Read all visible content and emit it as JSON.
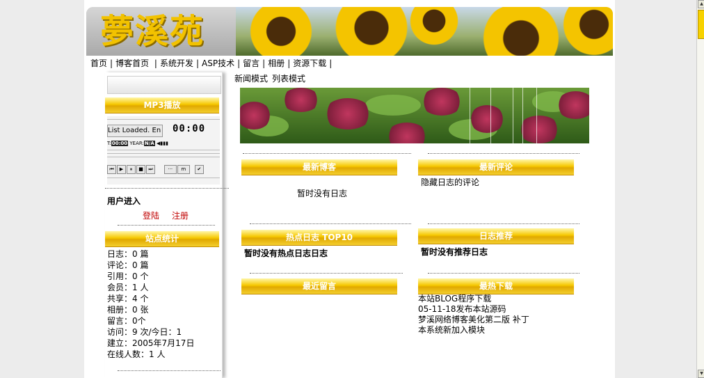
{
  "site": {
    "logo_text": "夢溪苑"
  },
  "nav": {
    "items": [
      "首页",
      "博客首页",
      "系统开发",
      "ASP技术",
      "留言",
      "相册",
      "资源下载"
    ]
  },
  "modes": {
    "news": "新闻模式",
    "list": "列表模式"
  },
  "sidebar": {
    "mp3": {
      "title": "MP3播放",
      "list_status": "List Loaded. En",
      "time": "00:00",
      "t_label": "T:",
      "t_value": "00:00",
      "year_label": "YEAR:",
      "year_value": "N/A",
      "buttons": [
        "⏮",
        "▶",
        "⏸",
        "■",
        "⏭",
        "···",
        "m",
        "✔"
      ]
    },
    "user": {
      "title": "用户进入",
      "login": "登陆",
      "register": "注册"
    },
    "stats": {
      "title": "站点统计",
      "lines": [
        "日志：0 篇",
        "评论：0 篇",
        "引用：0 个",
        "会员：1 人",
        "共享：4 个",
        "相册：0 张",
        "留言：0个",
        "访问：9 次/今日：1",
        "建立：2005年7月17日",
        "在线人数：1 人"
      ]
    }
  },
  "content": {
    "latest_blog": {
      "title": "最新博客",
      "empty": "暂时没有日志"
    },
    "latest_comments": {
      "title": "最新评论",
      "item": "隐藏日志的评论"
    },
    "hot_top10": {
      "title": "热点日志  TOP10",
      "empty": "暂时没有热点日志日志"
    },
    "recommended": {
      "title": "日志推荐",
      "empty": "暂时没有推荐日志"
    },
    "recent_messages": {
      "title": "最近留言"
    },
    "top_downloads": {
      "title": "最热下载",
      "items": [
        "本站BLOG程序下载",
        "05-11-18发布本站源码",
        "梦溪网络博客美化第二版 补丁",
        "本系统新加入模块"
      ]
    }
  }
}
